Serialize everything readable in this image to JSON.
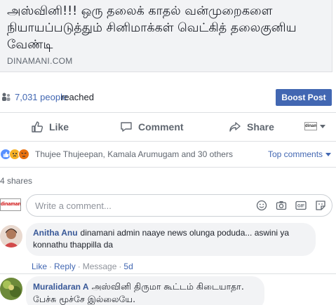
{
  "link_preview": {
    "title": "அஸ்வினி!!! ஒரு தலைக் காதல் வன்முறைகளை நியாயப்படுத்தும் சினிமாக்கள் வெட்கித் தலைகுனிய வேண்டி",
    "domain": "DINAMANI.COM"
  },
  "reach": {
    "count": "7,031 people",
    "suffix": "reached",
    "boost_label": "Boost Post"
  },
  "actions": {
    "like": "Like",
    "comment": "Comment",
    "share": "Share",
    "page_avatar_text": "dinamani"
  },
  "reactions": {
    "names": "Thujee Thujeepan, Kamala Arumugam and 30 others",
    "sort_label": "Top comments"
  },
  "shares": "4 shares",
  "composer": {
    "avatar_text": "dinamani",
    "placeholder": "Write a comment...",
    "icons": [
      "emoji-icon",
      "camera-icon",
      "gif-icon",
      "sticker-icon"
    ]
  },
  "comments": [
    {
      "author": "Anitha Anu",
      "text": "dinamani admin naaye news olunga poduda... aswini ya konnathu thappilla da",
      "like": "Like",
      "reply": "Reply",
      "message": "Message",
      "time": "5d"
    },
    {
      "author": "Muralidaran A",
      "text": "அஸ்வினி திருமா கூட்டம் கிடையாதா. பேச்சு மூச்சே இல்லையே."
    }
  ],
  "colors": {
    "brand_blue": "#4267b2",
    "author_blue": "#385898",
    "muted": "#606770",
    "card_bg": "#f2f3f5"
  }
}
